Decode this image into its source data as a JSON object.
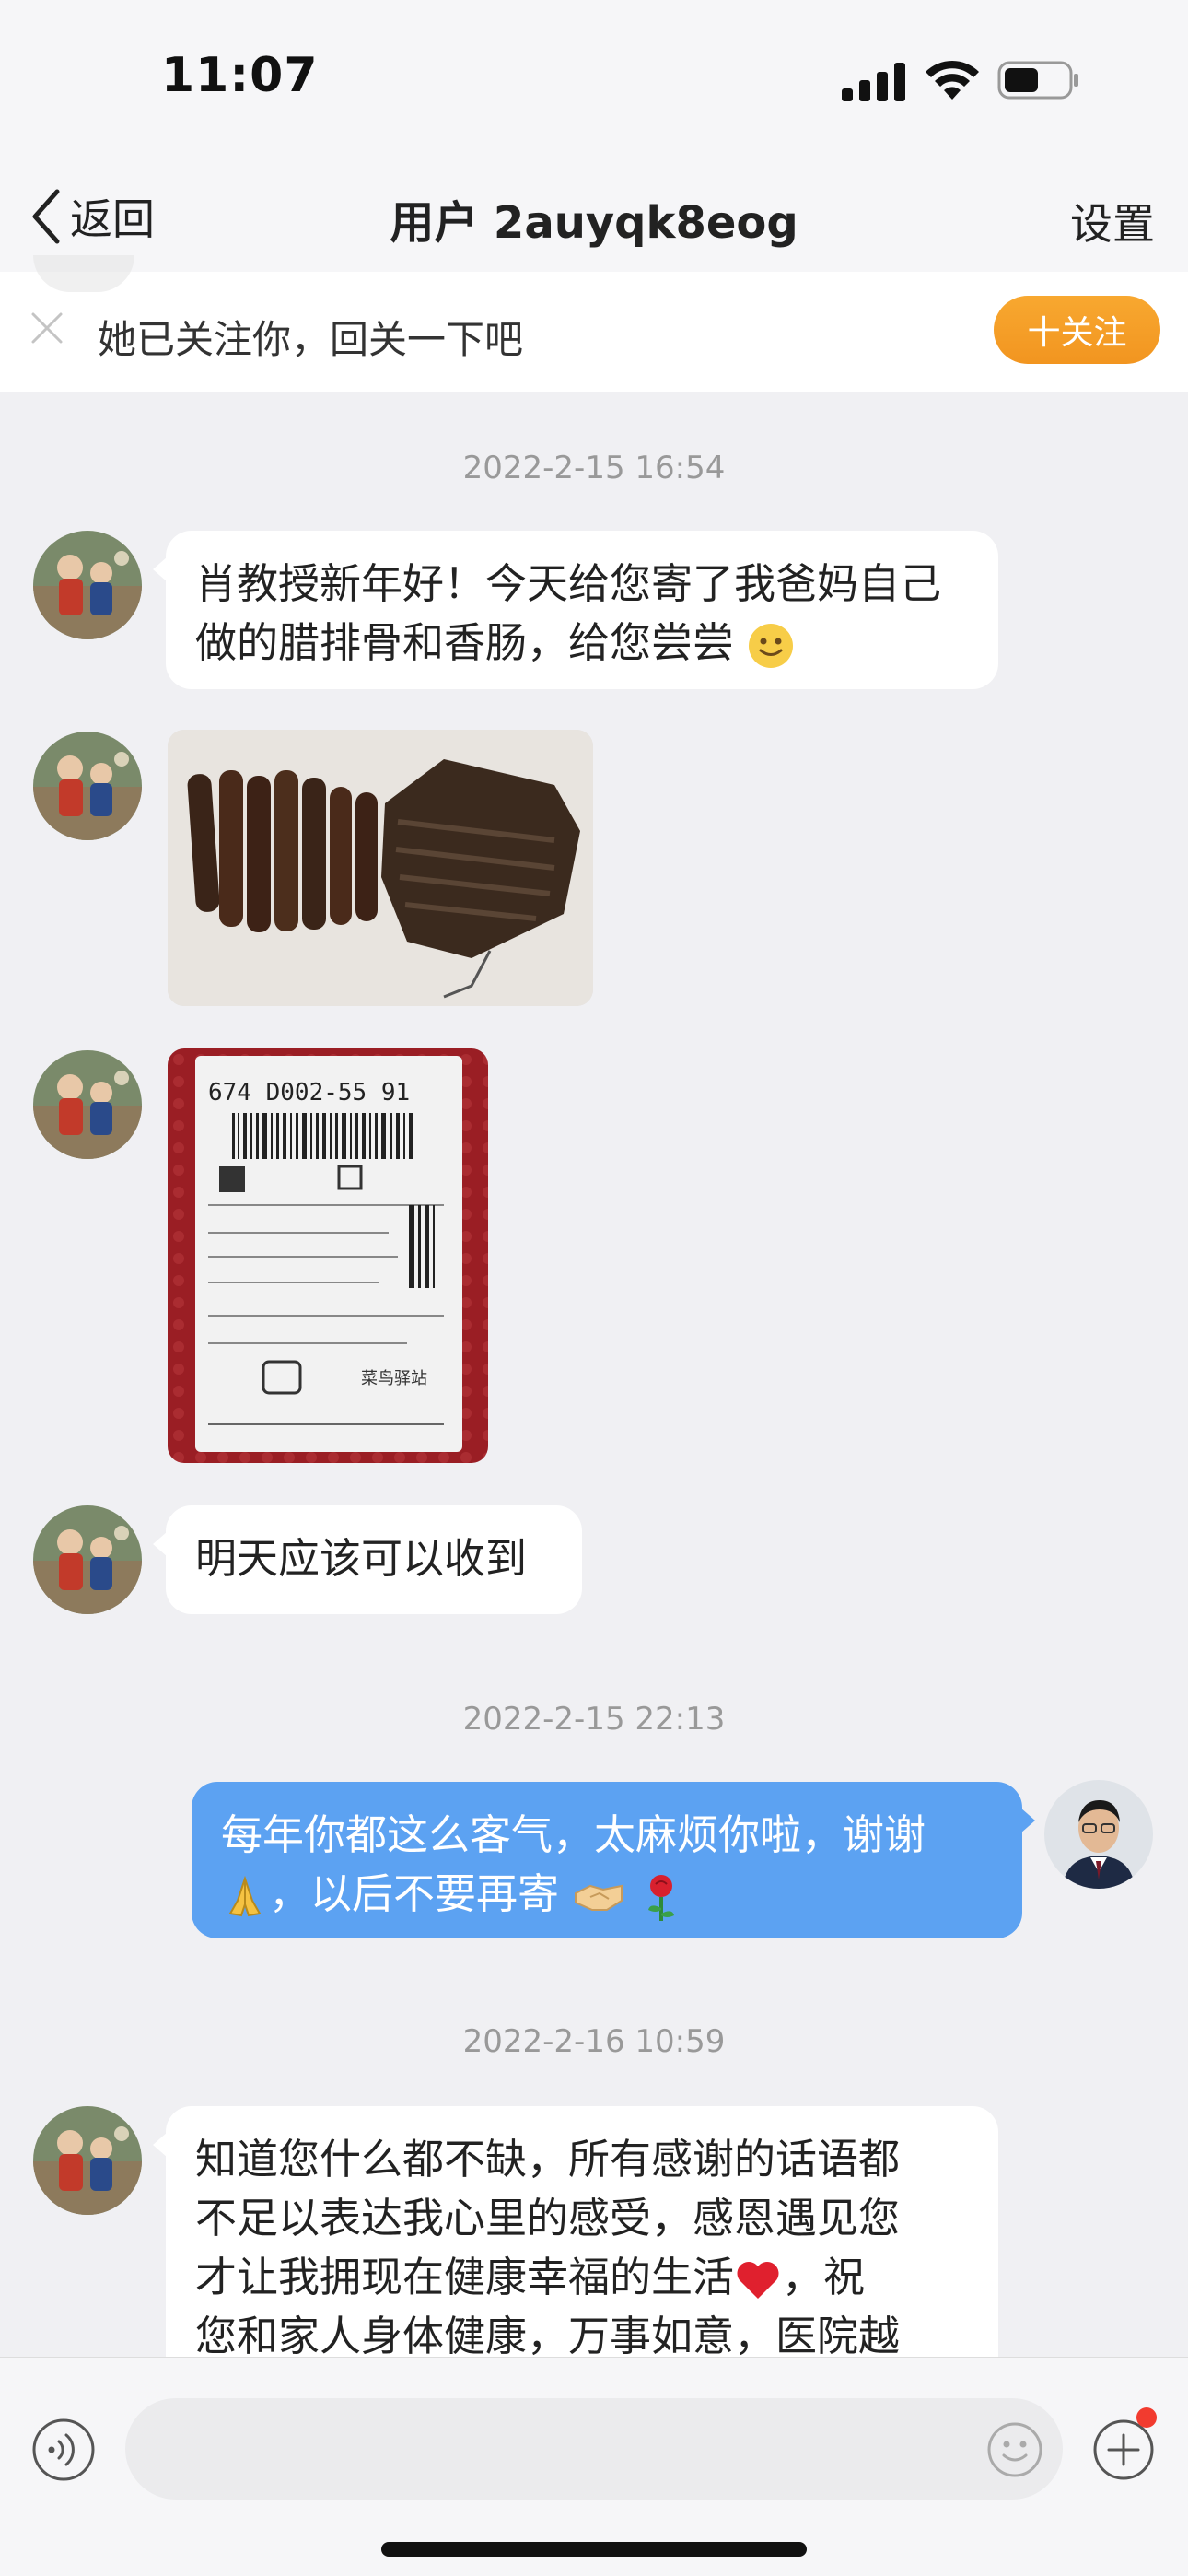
{
  "status_bar": {
    "time": "11:07"
  },
  "nav": {
    "back_label": "返回",
    "title": "用户 2auyqk8eog",
    "settings_label": "设置"
  },
  "follow_banner": {
    "text": "她已关注你，回关一下吧",
    "follow_button": "十关注"
  },
  "conversation": {
    "timestamps": [
      "2022-2-15 16:54",
      "2022-2-15 22:13",
      "2022-2-16 10:59"
    ],
    "msg1": {
      "sender": "other",
      "text": "肖教授新年好！今天给您寄了我爸妈自己做的腊排骨和香肠，给您尝尝",
      "emoji": "slightly-smiling-face"
    },
    "photo1": {
      "type": "photo",
      "subject": "cured-sausages-and-pork-ribs"
    },
    "photo2": {
      "type": "photo",
      "subject": "shipping-package-label",
      "label_code": "674 D002-55 91",
      "courier": "菜鸟驿站"
    },
    "msg2": {
      "sender": "other",
      "text": "明天应该可以收到"
    },
    "msg3": {
      "sender": "me",
      "line1": "每年你都这么客气，太麻烦你啦，谢谢",
      "line2": "，以后不要再寄",
      "emojis": [
        "folded-hands",
        "handshake",
        "rose"
      ]
    },
    "msg4": {
      "sender": "other",
      "lines": [
        "知道您什么都不缺，所有感谢的话语都",
        "不足以表达我心里的感受，感恩遇见您",
        "才让我拥现在健康幸福的生活",
        "，祝",
        "您和家人身体健康，万事如意，医院越"
      ],
      "emoji": "red-heart"
    }
  },
  "input_bar": {
    "placeholder": ""
  },
  "colors": {
    "outgoing_bubble": "#5ca2f2",
    "follow_button": "#f29520",
    "background": "#f0f0f3"
  }
}
